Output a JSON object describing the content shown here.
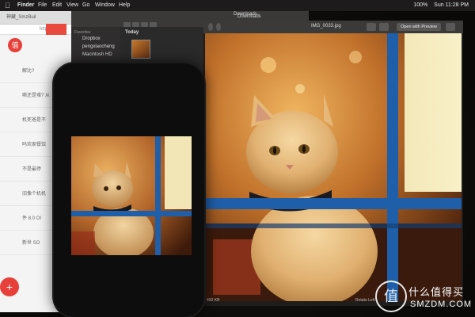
{
  "menubar": {
    "apple_icon": "apple-icon",
    "app_name": "Finder",
    "menus": [
      "File",
      "Edit",
      "View",
      "Go",
      "Window",
      "Help"
    ],
    "battery": "100%",
    "clock": "Sun 11:28 PM"
  },
  "browser": {
    "tab_text": "神藏_SmzBuil",
    "address": "https://",
    "logo": "值",
    "items": [
      "解比?",
      "嘶还是难? 从",
      "机死爸是不",
      "吗欢家餐馆",
      "不是最停",
      "旧像个机机",
      "件 8.0 OI",
      "新世 SO"
    ],
    "fab": "+"
  },
  "finder": {
    "sidebar_heading": "Favorites",
    "sidebar_items": [
      "Dropbox",
      "pengxiaocheng",
      "Macintosh HD"
    ],
    "section": "Today",
    "window_title": "Downloads"
  },
  "preview": {
    "filename": "IMG_0033.jpg",
    "open_button": "Open with Preview",
    "footer_left": "Rotate Left",
    "footer_size": "493 KB"
  },
  "watermark": {
    "logo_char": "值",
    "cn": "什么值得买",
    "en": "SMZDM.COM"
  },
  "colors": {
    "accent_red": "#e7403a",
    "window_blue": "#1f5ea8",
    "warm_orange": "#d98a3a"
  }
}
